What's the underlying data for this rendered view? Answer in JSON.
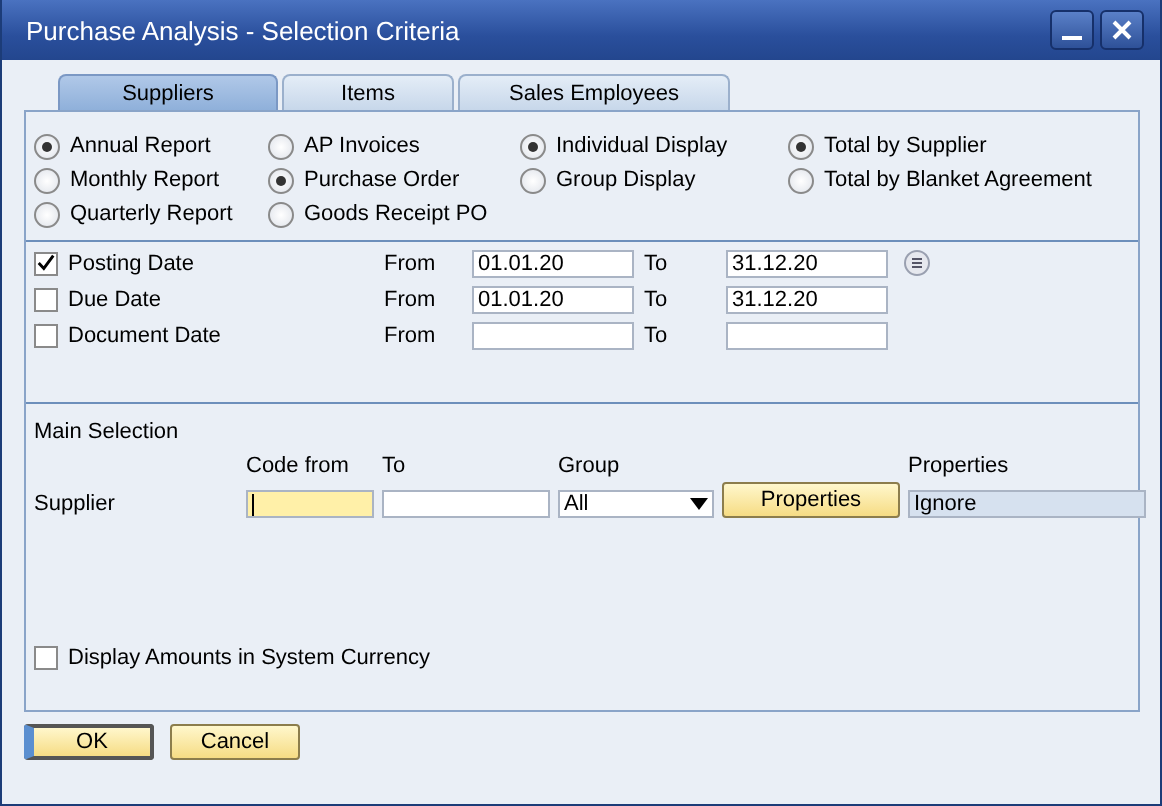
{
  "window": {
    "title": "Purchase Analysis - Selection Criteria"
  },
  "tabs": [
    {
      "label": "Suppliers",
      "selected": true
    },
    {
      "label": "Items",
      "selected": false
    },
    {
      "label": "Sales Employees",
      "selected": false
    }
  ],
  "radio_groups": [
    {
      "options": [
        {
          "label": "Annual Report",
          "selected": true
        },
        {
          "label": "Monthly Report",
          "selected": false
        },
        {
          "label": "Quarterly Report",
          "selected": false
        }
      ]
    },
    {
      "options": [
        {
          "label": "AP Invoices",
          "selected": false
        },
        {
          "label": "Purchase Order",
          "selected": true
        },
        {
          "label": "Goods Receipt PO",
          "selected": false
        }
      ]
    },
    {
      "options": [
        {
          "label": "Individual Display",
          "selected": true
        },
        {
          "label": "Group Display",
          "selected": false
        }
      ]
    },
    {
      "options": [
        {
          "label": "Total by Supplier",
          "selected": true
        },
        {
          "label": "Total by Blanket Agreement",
          "selected": false
        }
      ]
    }
  ],
  "date_filters": [
    {
      "label": "Posting Date",
      "checked": true,
      "from_label": "From",
      "from": "01.01.20",
      "to_label": "To",
      "to": "31.12.20",
      "picker": true
    },
    {
      "label": "Due Date",
      "checked": false,
      "from_label": "From",
      "from": "01.01.20",
      "to_label": "To",
      "to": "31.12.20"
    },
    {
      "label": "Document Date",
      "checked": false,
      "from_label": "From",
      "to_label": "To"
    }
  ],
  "main_selection": {
    "title": "Main Selection",
    "columns": [
      "Code from",
      "To",
      "Group",
      "Properties"
    ],
    "row": {
      "label": "Supplier",
      "code_from_focused": true,
      "group": "All",
      "button": "Properties",
      "properties": "Ignore"
    }
  },
  "options": [
    {
      "label": "Display Amounts in System Currency",
      "checked": false
    }
  ],
  "buttons": [
    {
      "label": "OK",
      "default": true
    },
    {
      "label": "Cancel",
      "default": false
    }
  ]
}
